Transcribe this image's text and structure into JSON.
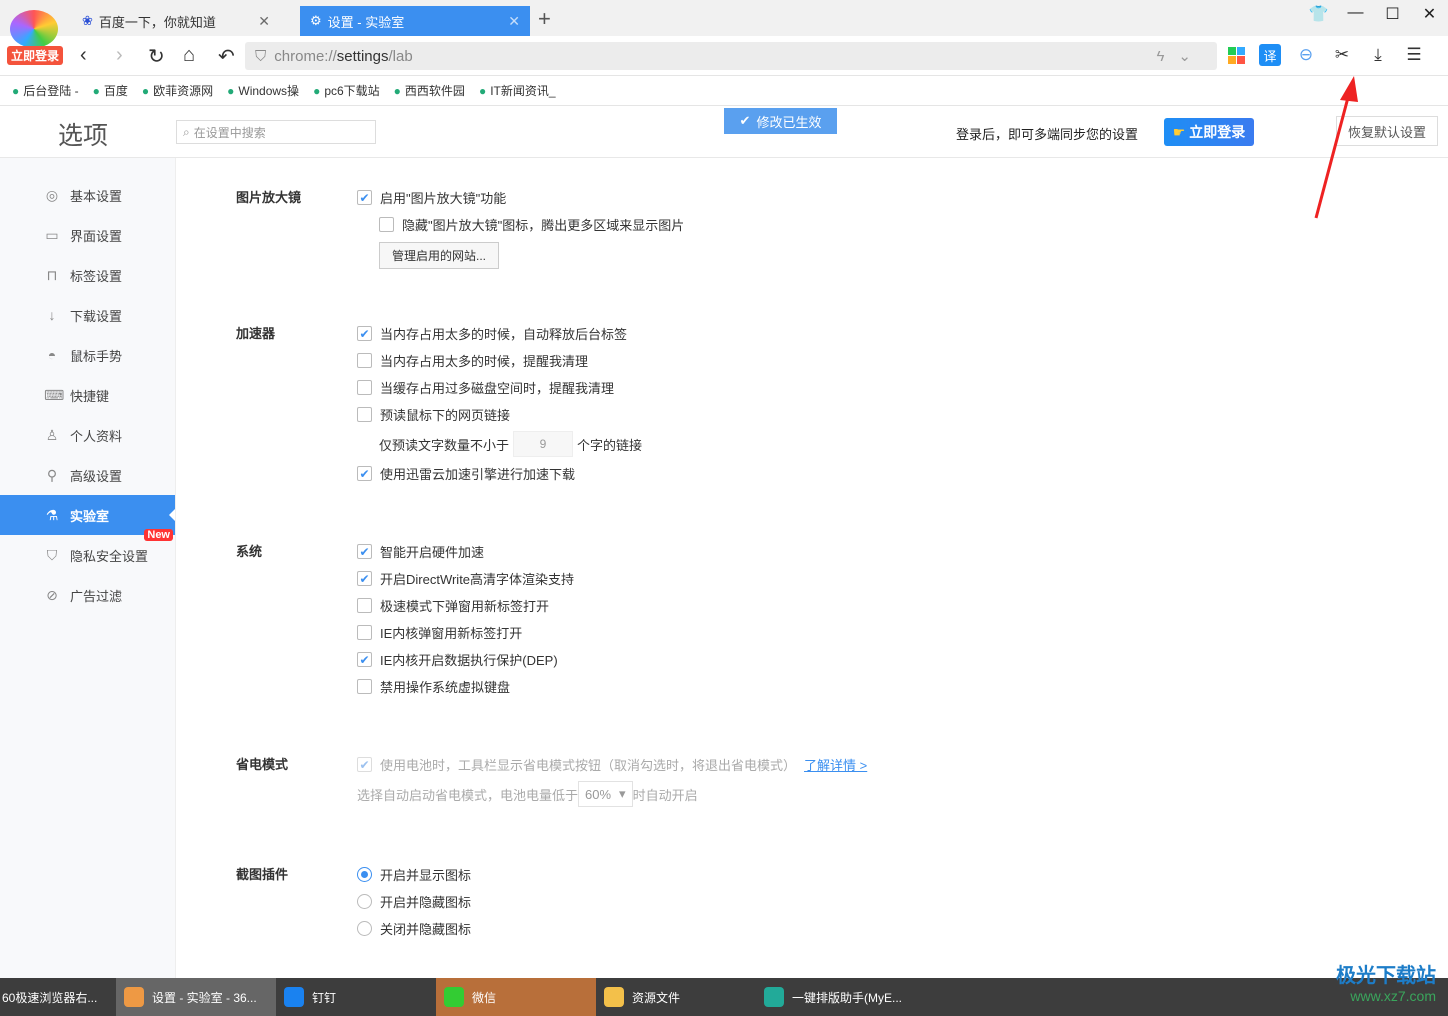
{
  "browser": {
    "login_badge": "立即登录",
    "tabs": [
      {
        "title": "百度一下，你就知道",
        "icon": "baidu-paw-icon",
        "active": false
      },
      {
        "title": "设置 - 实验室",
        "icon": "gear-icon",
        "active": true
      }
    ],
    "url_scheme": "chrome://",
    "url_path_main": "settings",
    "url_path_rest": "/lab",
    "bookmarks": [
      "后台登陆 -",
      "百度",
      "欧菲资源网",
      "Windows操",
      "pc6下载站",
      "西西软件园",
      "IT新闻资讯_"
    ]
  },
  "header": {
    "title": "选项",
    "search_placeholder": "在设置中搜索",
    "toast": "修改已生效",
    "sync_text": "登录后，即可多端同步您的设置",
    "login_button": "立即登录",
    "reset_button": "恢复默认设置"
  },
  "sidebar": {
    "items": [
      {
        "label": "基本设置",
        "icon": "settings-circle-icon"
      },
      {
        "label": "界面设置",
        "icon": "window-icon"
      },
      {
        "label": "标签设置",
        "icon": "tab-icon"
      },
      {
        "label": "下载设置",
        "icon": "download-icon"
      },
      {
        "label": "鼠标手势",
        "icon": "mouse-icon"
      },
      {
        "label": "快捷键",
        "icon": "keyboard-icon"
      },
      {
        "label": "个人资料",
        "icon": "user-icon"
      },
      {
        "label": "高级设置",
        "icon": "wrench-icon"
      },
      {
        "label": "实验室",
        "icon": "flask-icon",
        "active": true,
        "badge": "New"
      },
      {
        "label": "隐私安全设置",
        "icon": "shield-icon"
      },
      {
        "label": "广告过滤",
        "icon": "block-icon"
      }
    ]
  },
  "sections": [
    {
      "label": "图片放大镜",
      "items": [
        {
          "type": "checkbox",
          "checked": true,
          "label": "启用\"图片放大镜\"功能"
        },
        {
          "type": "checkbox",
          "checked": false,
          "indent": true,
          "label": "隐藏\"图片放大镜\"图标，腾出更多区域来显示图片"
        },
        {
          "type": "button",
          "label": "管理启用的网站..."
        }
      ]
    },
    {
      "label": "加速器",
      "items": [
        {
          "type": "checkbox",
          "checked": true,
          "label": "当内存占用太多的时候，自动释放后台标签"
        },
        {
          "type": "checkbox",
          "checked": false,
          "label": "当内存占用太多的时候，提醒我清理"
        },
        {
          "type": "checkbox",
          "checked": false,
          "label": "当缓存占用过多磁盘空间时，提醒我清理"
        },
        {
          "type": "checkbox",
          "checked": false,
          "label": "预读鼠标下的网页链接"
        },
        {
          "type": "number",
          "before": "仅预读文字数量不小于",
          "value": "9",
          "after": "个字的链接"
        },
        {
          "type": "checkbox",
          "checked": true,
          "label": "使用迅雷云加速引擎进行加速下载"
        }
      ]
    },
    {
      "label": "系统",
      "items": [
        {
          "type": "checkbox",
          "checked": true,
          "label": "智能开启硬件加速"
        },
        {
          "type": "checkbox",
          "checked": true,
          "label": "开启DirectWrite高清字体渲染支持"
        },
        {
          "type": "checkbox",
          "checked": false,
          "label": "极速模式下弹窗用新标签打开"
        },
        {
          "type": "checkbox",
          "checked": false,
          "label": "IE内核弹窗用新标签打开"
        },
        {
          "type": "checkbox",
          "checked": true,
          "label": "IE内核开启数据执行保护(DEP)"
        },
        {
          "type": "checkbox",
          "checked": false,
          "label": "禁用操作系统虚拟键盘"
        }
      ]
    },
    {
      "label": "省电模式",
      "items": [
        {
          "type": "checkbox",
          "checked": true,
          "disabled": true,
          "label": "使用电池时，工具栏显示省电模式按钮（取消勾选时，将退出省电模式）",
          "link": "了解详情 >"
        },
        {
          "type": "select",
          "before": "选择自动启动省电模式，电池电量低于",
          "value": "60%",
          "after": "时自动开启"
        }
      ]
    },
    {
      "label": "截图插件",
      "items": [
        {
          "type": "radio",
          "checked": true,
          "label": "开启并显示图标"
        },
        {
          "type": "radio",
          "checked": false,
          "label": "开启并隐藏图标"
        },
        {
          "type": "radio",
          "checked": false,
          "label": "关闭并隐藏图标"
        }
      ]
    }
  ],
  "taskbar": [
    {
      "label": "60极速浏览器右...",
      "color": "#3d3d3d"
    },
    {
      "label": "设置 - 实验室 - 36...",
      "color": "#e94"
    },
    {
      "label": "钉钉",
      "color": "#1a82f0"
    },
    {
      "label": "微信",
      "color": "#3c3"
    },
    {
      "label": "资源文件",
      "color": "#f3c04a"
    },
    {
      "label": "一键排版助手(MyE...",
      "color": "#2a9"
    }
  ],
  "watermark": {
    "name": "极光下载站",
    "url": "www.xz7.com"
  },
  "colors": {
    "accent": "#3b8ff0",
    "taskbar": "#3d3d3d",
    "active_taskbar": "#b86f3a"
  }
}
